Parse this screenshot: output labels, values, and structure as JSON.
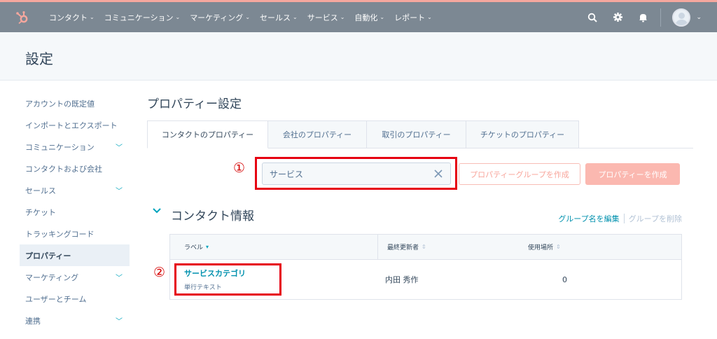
{
  "topnav": {
    "items": [
      {
        "label": "コンタクト"
      },
      {
        "label": "コミュニケーション"
      },
      {
        "label": "マーケティング"
      },
      {
        "label": "セールス"
      },
      {
        "label": "サービス"
      },
      {
        "label": "自動化"
      },
      {
        "label": "レポート"
      }
    ],
    "icons": [
      "search-icon",
      "gear-icon",
      "bell-icon",
      "avatar"
    ],
    "brand_color": "#7c8893",
    "accent_color": "#f5a79e"
  },
  "page": {
    "title": "設定"
  },
  "sidebar": {
    "items": [
      {
        "label": "アカウントの既定値"
      },
      {
        "label": "インポートとエクスポート"
      },
      {
        "label": "コミュニケーション"
      },
      {
        "label": "コンタクトおよび会社"
      },
      {
        "label": "セールス"
      },
      {
        "label": "チケット"
      },
      {
        "label": "トラッキングコード"
      },
      {
        "label": "プロパティー"
      },
      {
        "label": "マーケティング"
      },
      {
        "label": "ユーザーとチーム"
      },
      {
        "label": "連携"
      }
    ]
  },
  "main": {
    "title": "プロパティー設定",
    "tabs": [
      {
        "label": "コンタクトのプロパティー"
      },
      {
        "label": "会社のプロパティー"
      },
      {
        "label": "取引のプロパティー"
      },
      {
        "label": "チケットのプロパティー"
      }
    ],
    "search": {
      "value": "サービス"
    },
    "buttons": {
      "create_group": "プロパティーグループを作成",
      "create_property": "プロパティーを作成"
    },
    "annotations": {
      "one": "①",
      "two": "②"
    }
  },
  "group": {
    "title": "コンタクト情報",
    "edit": "グループ名を編集",
    "delete": "グループを削除"
  },
  "table": {
    "columns": {
      "label": "ラベル",
      "updated_by": "最終更新者",
      "used_in": "使用場所"
    },
    "rows": [
      {
        "name": "サービスカテゴリ",
        "type": "単行テキスト",
        "updated_by": "内田 秀作",
        "used_in": "0"
      }
    ]
  }
}
